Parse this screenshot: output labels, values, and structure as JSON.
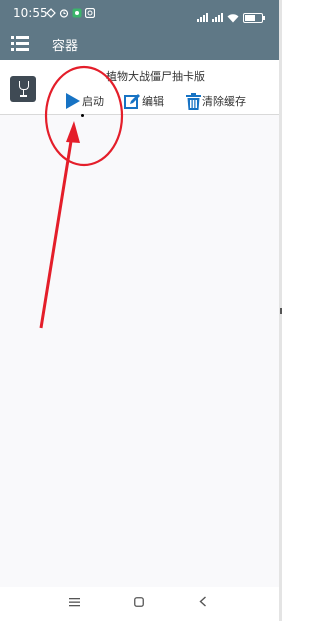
{
  "status_bar": {
    "time": "10:55",
    "left_icons": [
      "signal-sync-icon",
      "alarm-icon",
      "app-notification-icon",
      "camera-notification-icon"
    ],
    "right_icons": [
      "signal-icon",
      "signal-icon",
      "wifi-icon",
      "battery-icon"
    ]
  },
  "app_bar": {
    "title": "容器",
    "menu_icon": "menu-list-icon"
  },
  "container_item": {
    "name": "植物大战僵尸抽卡版",
    "icon": "wine-glass-icon",
    "actions": {
      "start_label": "启动",
      "edit_label": "编辑",
      "clear_cache_label": "清除缓存"
    }
  },
  "colors": {
    "bar": "#5f7886",
    "accent": "#1773c4",
    "annotation": "#e41e2a"
  },
  "nav_bar": {
    "recent_icon": "recent-apps-icon",
    "home_icon": "home-icon",
    "back_icon": "back-icon"
  }
}
